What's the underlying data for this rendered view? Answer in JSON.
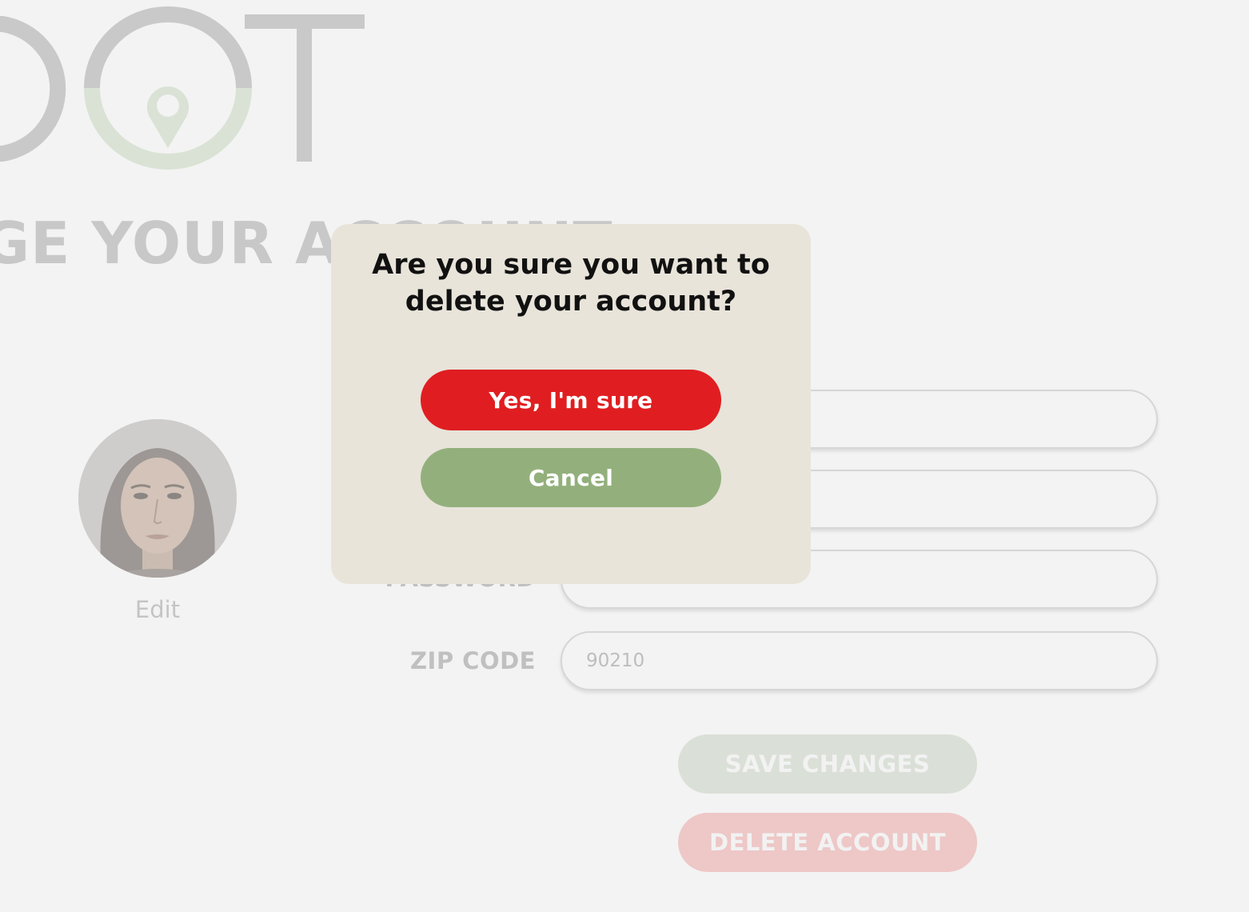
{
  "logo": {
    "icon": "map-pin-icon",
    "color_gray": "#c9c9c9",
    "color_green": "#d9e2d4"
  },
  "header": {
    "title": "GE YOUR ACCOUNT"
  },
  "profile": {
    "edit_label": "Edit"
  },
  "form": {
    "fields": [
      {
        "label": "",
        "value": ""
      },
      {
        "label": "",
        "value": ""
      },
      {
        "label": "PASSWORD",
        "value": ""
      },
      {
        "label": "ZIP CODE",
        "value": "",
        "placeholder": "90210"
      }
    ],
    "save_label": "SAVE CHANGES",
    "delete_label": "DELETE ACCOUNT"
  },
  "modal": {
    "title": "Are you sure you want to delete your account?",
    "confirm_label": "Yes, I'm sure",
    "cancel_label": "Cancel",
    "colors": {
      "background": "#e8e4da",
      "confirm": "#e01e21",
      "cancel": "#93b07c"
    }
  }
}
